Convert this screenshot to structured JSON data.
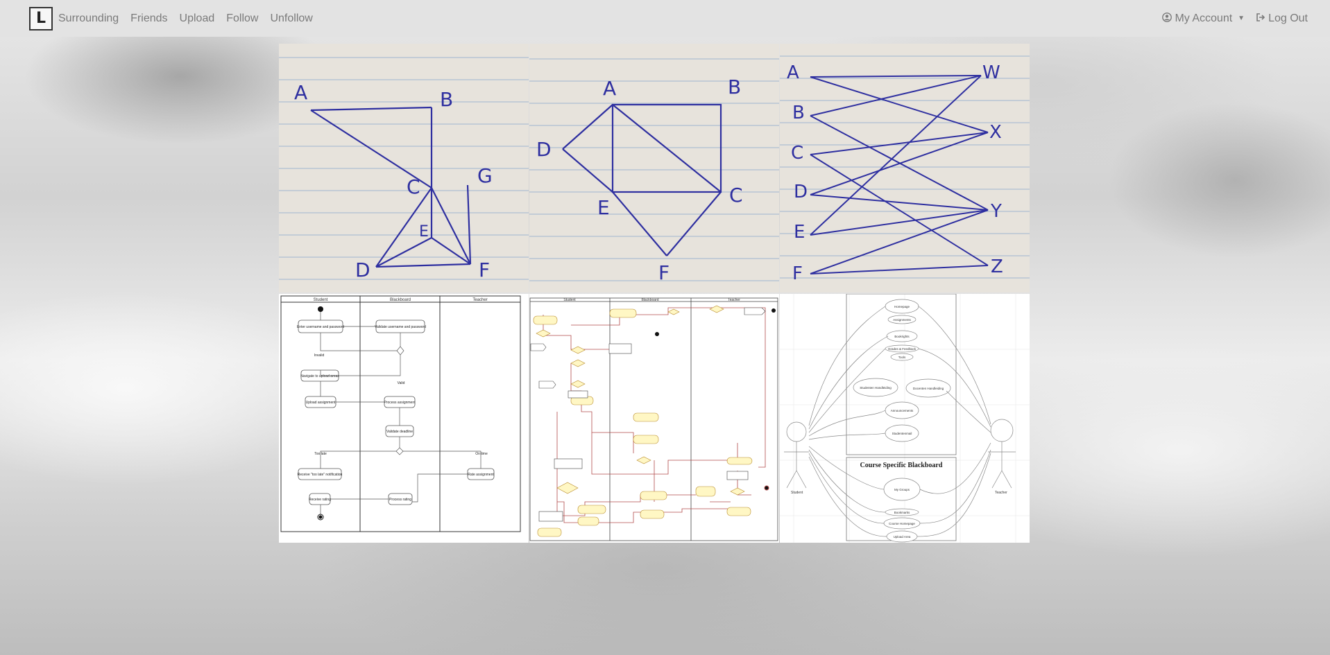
{
  "navbar": {
    "brand_letter": "L",
    "links": [
      "Surrounding",
      "Friends",
      "Upload",
      "Follow",
      "Unfollow"
    ],
    "account_label": "My Account",
    "logout_label": "Log Out"
  },
  "gallery": {
    "photos": [
      {
        "kind": "graph-sketch",
        "labels": [
          "A",
          "B",
          "C",
          "E",
          "G",
          "D",
          "F"
        ]
      },
      {
        "kind": "graph-sketch",
        "labels": [
          "A",
          "B",
          "D",
          "E",
          "C",
          "F"
        ]
      },
      {
        "kind": "bipartite-sketch",
        "labels": [
          "A",
          "B",
          "C",
          "D",
          "E",
          "F",
          "W",
          "X",
          "Y",
          "Z"
        ]
      },
      {
        "kind": "activity-diagram",
        "lanes": [
          "Student",
          "Blackboard",
          "Teacher"
        ],
        "nodes": [
          "Enter username and password",
          "Validate username and password",
          "Navigate to upload areas",
          "Upload assignment",
          "Process assignment",
          "Validate deadline",
          "Receive \"too late\" notification",
          "Rate assignment",
          "Receive rating",
          "Process rating"
        ],
        "guards": [
          "Invalid",
          "Valid",
          "Too late",
          "On time"
        ]
      },
      {
        "kind": "activity-diagram",
        "lanes": [
          "Student",
          "Blackboard",
          "Teacher"
        ]
      },
      {
        "kind": "use-case-diagram",
        "use_cases": [
          "Homepage",
          "Assignments",
          "Bookrights",
          "Grades & Feedback",
          "Tools",
          "Studenten Handleiding",
          "Docenten Handleiding",
          "Announcements",
          "Studentenmail",
          "My Groups",
          "Bookmarks",
          "Course Homepage",
          "Upload Area"
        ],
        "box_title": "Course Specific Blackboard",
        "actors": [
          "Student",
          "Teacher"
        ]
      }
    ]
  },
  "colors": {
    "navbar_bg": "#e3e3e3",
    "nav_text": "#7a7a7a",
    "ink": "#2a2aa0",
    "paper": "#e9e5dd",
    "diagram_yellow": "#fff7c4",
    "diagram_line": "#b34b4b"
  },
  "icons": {
    "account": "user-circle-icon",
    "logout": "sign-out-icon",
    "dropdown": "caret-down-icon"
  }
}
